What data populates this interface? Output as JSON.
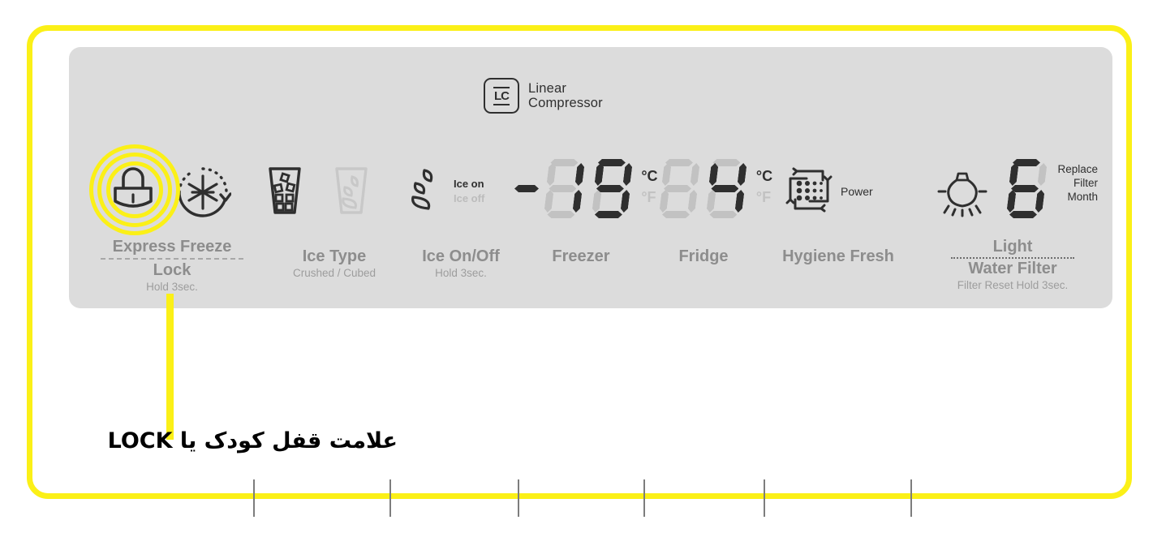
{
  "panel": {
    "brand": {
      "badge": "LC",
      "line1": "Linear",
      "line2": "Compressor"
    },
    "colors": {
      "highlight": "#fbf017",
      "panel_bg": "#dcdcdc",
      "segment_on": "#2f2f2f",
      "segment_off": "#c2c2c2",
      "label": "#8d8d8d"
    },
    "sections": [
      {
        "id": "express-freeze-lock",
        "icons": [
          "lock-icon",
          "express-freeze-snowflake-icon"
        ],
        "label_main": "Express Freeze",
        "separator": "dashed",
        "label_main2": "Lock",
        "label_sub": "Hold 3sec."
      },
      {
        "id": "ice-type",
        "icons": [
          "cubed-ice-glass-icon",
          "crushed-ice-glass-icon"
        ],
        "label_main": "Ice Type",
        "label_sub": "Crushed / Cubed"
      },
      {
        "id": "ice-on-off",
        "icons": [
          "ice-maker-icon"
        ],
        "state_on": "Ice on",
        "state_off": "Ice off",
        "label_main": "Ice On/Off",
        "label_sub": "Hold 3sec."
      },
      {
        "id": "freezer",
        "value": "-19",
        "unit_active": "°C",
        "unit_inactive": "°F",
        "label_main": "Freezer"
      },
      {
        "id": "fridge",
        "value": "4",
        "unit_active": "°C",
        "unit_inactive": "°F",
        "label_main": "Fridge"
      },
      {
        "id": "hygiene-fresh",
        "icons": [
          "hygiene-fresh-icon"
        ],
        "indicator": "Power",
        "label_main": "Hygiene Fresh"
      },
      {
        "id": "light-water-filter",
        "icons": [
          "light-bulb-icon"
        ],
        "filter_digit": "6",
        "filter_text_line1": "Replace",
        "filter_text_line2": "Filter",
        "filter_text_line3": "Month",
        "label_main": "Light",
        "separator": "dotted",
        "label_main2": "Water Filter",
        "label_sub": "Filter Reset Hold 3sec."
      }
    ]
  },
  "annotation": {
    "caption": "علامت قفل کودک یا LOCK",
    "target": "lock-icon"
  }
}
